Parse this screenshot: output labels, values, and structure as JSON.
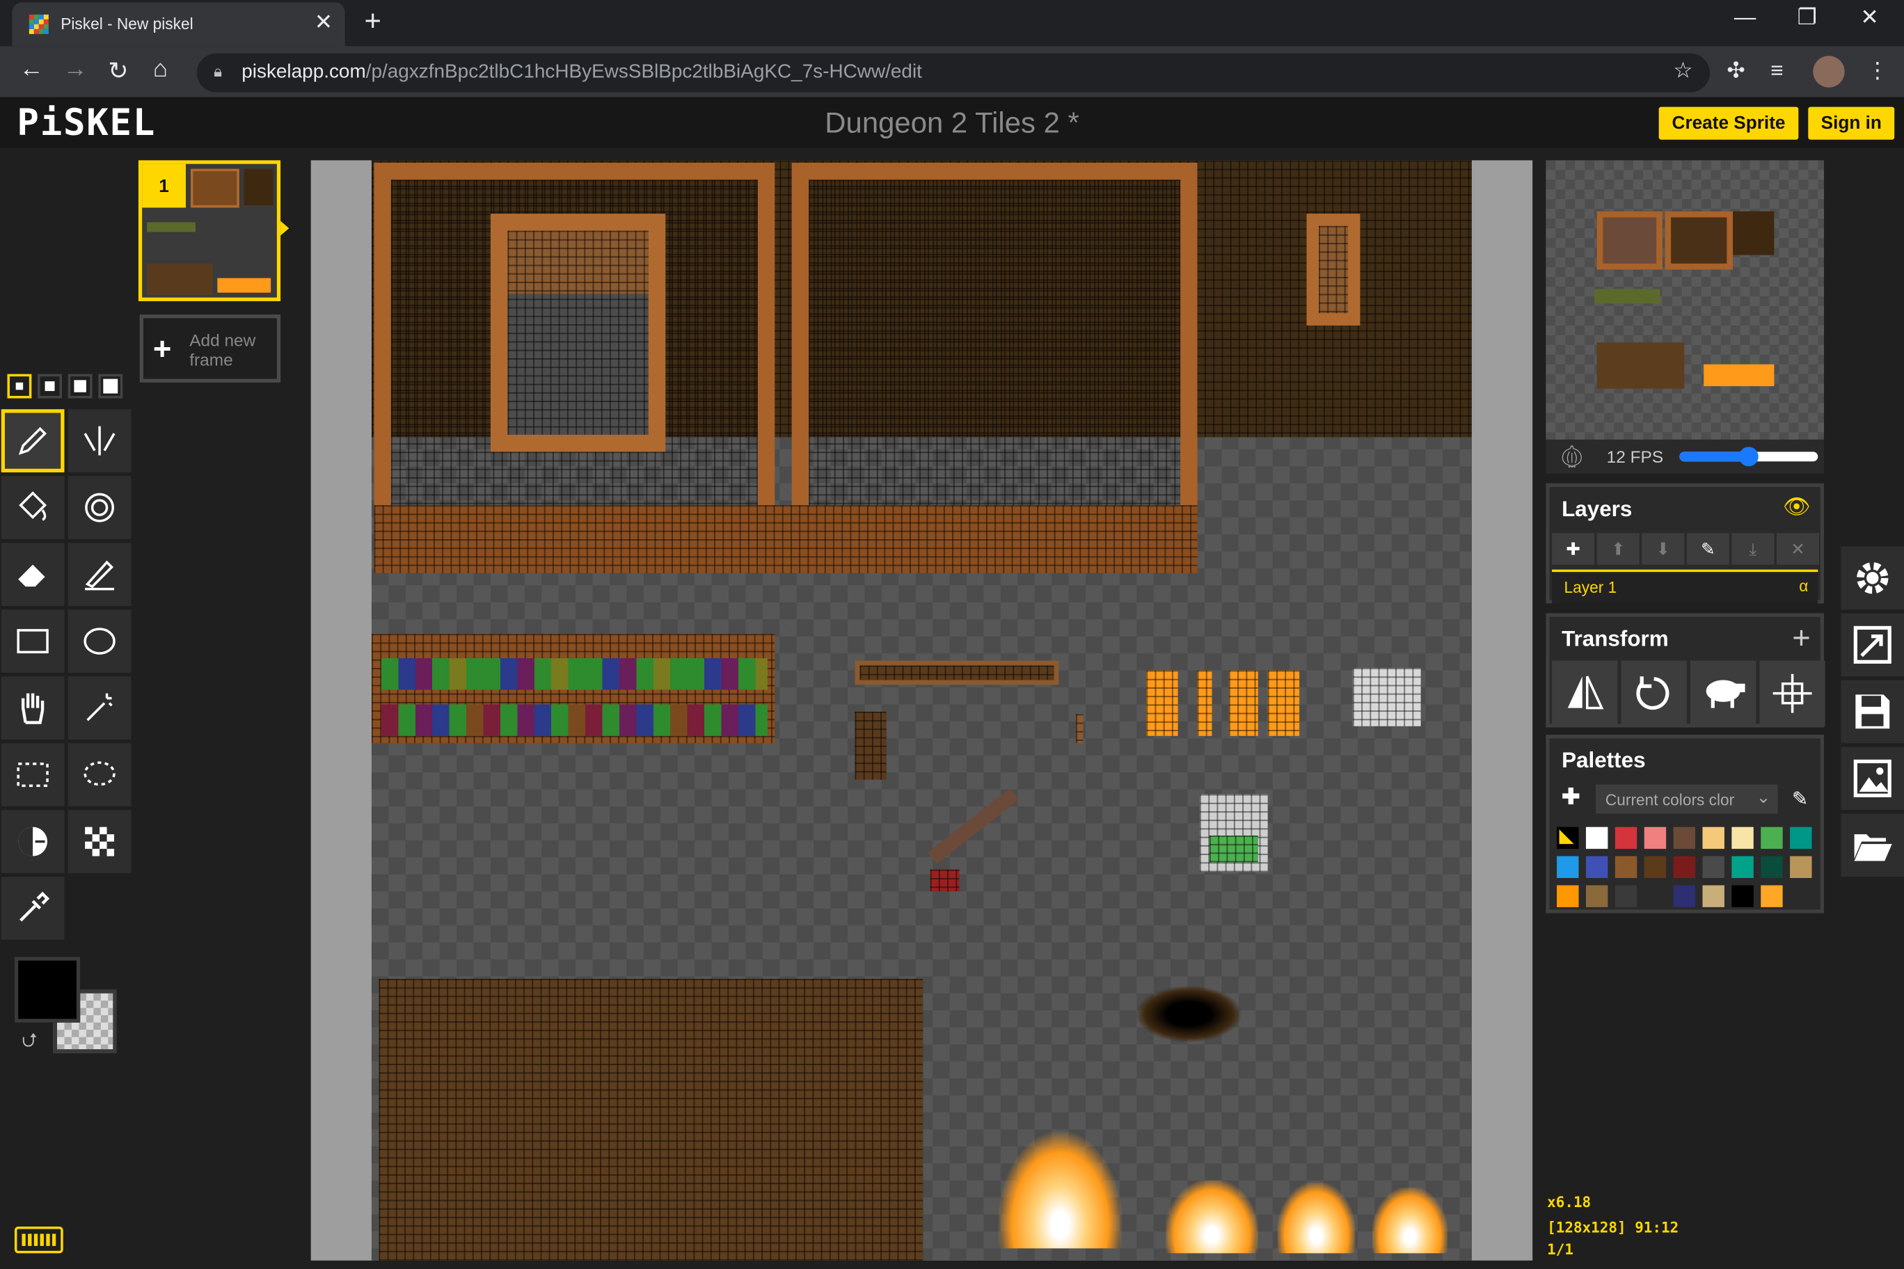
{
  "browser": {
    "tab_title": "Piskel - New piskel",
    "url_host": "piskelapp.com",
    "url_path": "/p/agxzfnBpc2tlbC1hcHByEwsSBlBpc2tlbBiAgKC_7s-HCww/edit"
  },
  "app": {
    "logo": "PiSKEL",
    "doc_title": "Dungeon 2 Tiles 2 *",
    "create_sprite": "Create Sprite",
    "sign_in": "Sign in"
  },
  "frames": {
    "frame_number": "1",
    "add_new_frame": "Add new frame"
  },
  "preview": {
    "fps": "12 FPS",
    "fps_value": 12,
    "fps_slider_fraction": 0.5
  },
  "layers": {
    "title": "Layers",
    "items": [
      {
        "label": "Layer 1",
        "alpha": "α"
      }
    ]
  },
  "transform": {
    "title": "Transform"
  },
  "palettes": {
    "title": "Palettes",
    "selected": "Current colors clor",
    "colors": [
      "#ffffff",
      "#d4343c",
      "#f08080",
      "#6b4a3a",
      "#f5c97a",
      "#f9e4a8",
      "#4caf50",
      "#009688",
      "#1e9ae8",
      "#3f51b5",
      "#8b5a2b",
      "#5d3a1a",
      "#7b1c1c",
      "#4a4a4a",
      "#00a38a",
      "#0a4d3c",
      "#b8965a",
      "#ff9800",
      "#8a6a3a",
      "#3a3a3a",
      "#2a2a2a",
      "#2e2e72",
      "#c9ae7a",
      "#000000",
      "#ffa726"
    ]
  },
  "colors": {
    "primary": "#000000",
    "secondary": "transparent",
    "accent": "#ffd700"
  },
  "status": {
    "zoom": "x6.18",
    "size_pos": "[128x128] 91:12",
    "frame": "1/1"
  }
}
